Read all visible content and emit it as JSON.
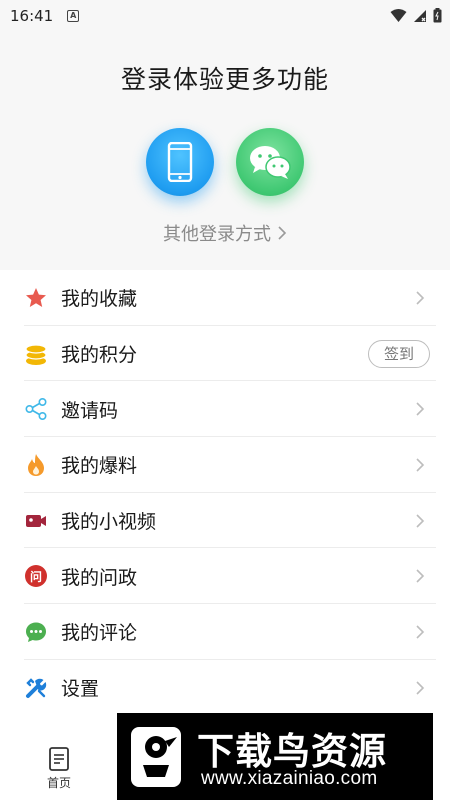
{
  "status_bar": {
    "time": "16:41",
    "notification_icon": "A"
  },
  "login": {
    "title": "登录体验更多功能",
    "other_login": "其他登录方式",
    "phone_icon": "phone-icon",
    "wechat_icon": "wechat-icon"
  },
  "menu": {
    "items": [
      {
        "label": "我的收藏",
        "icon": "star-icon",
        "color": "#e85a4f"
      },
      {
        "label": "我的积分",
        "icon": "coins-icon",
        "color": "#f2b705",
        "action_label": "签到"
      },
      {
        "label": "邀请码",
        "icon": "share-icon",
        "color": "#3fb8e8"
      },
      {
        "label": "我的爆料",
        "icon": "flame-icon",
        "color": "#f59a2b"
      },
      {
        "label": "我的小视频",
        "icon": "video-icon",
        "color": "#a3253c"
      },
      {
        "label": "我的问政",
        "icon": "question-icon",
        "color": "#d0312d",
        "icon_text": "问"
      },
      {
        "label": "我的评论",
        "icon": "comment-icon",
        "color": "#4caf50"
      },
      {
        "label": "设置",
        "icon": "settings-icon",
        "color": "#1e7fd9"
      }
    ]
  },
  "bottom_nav": {
    "home_label": "首页"
  },
  "watermark": {
    "title": "下载鸟资源",
    "url": "www.xiazainiao.com"
  }
}
